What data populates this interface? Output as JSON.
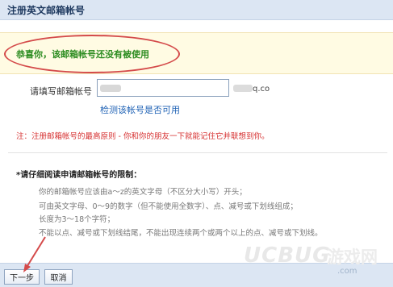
{
  "window": {
    "title": "注册英文邮箱帐号"
  },
  "notice": {
    "message": "恭喜你，该邮箱帐号还没有被使用"
  },
  "form": {
    "label": "请填写邮箱帐号",
    "email_domain_suffix": "q.co",
    "check_link": "检测该帐号是否可用"
  },
  "note": "注：注册邮箱帐号的最高原则 - 你和你的朋友一下就能记住它并联想到你。",
  "rules": {
    "title": "*请仔细阅读申请邮箱帐号的限制：",
    "items": [
      "你的邮箱帐号应该由a～z的英文字母（不区分大小写）开头；",
      "可由英文字母、0～9的数字（但不能使用全数字）、点、减号或下划线组成；",
      "长度为3～18个字符；",
      "不能以点、减号或下划线结尾，不能出现连续两个或两个以上的点、减号或下划线。"
    ]
  },
  "buttons": {
    "next": "下一步",
    "cancel": "取消"
  },
  "watermark": {
    "logo": "UCBUG",
    "slogan": "游戏网",
    "url": ".com"
  },
  "colors": {
    "success_text": "#2c8c20",
    "warning_text": "#d63030",
    "link": "#1f62b5",
    "annotation": "#d44a4a",
    "bar_bg": "#dce6f3"
  }
}
